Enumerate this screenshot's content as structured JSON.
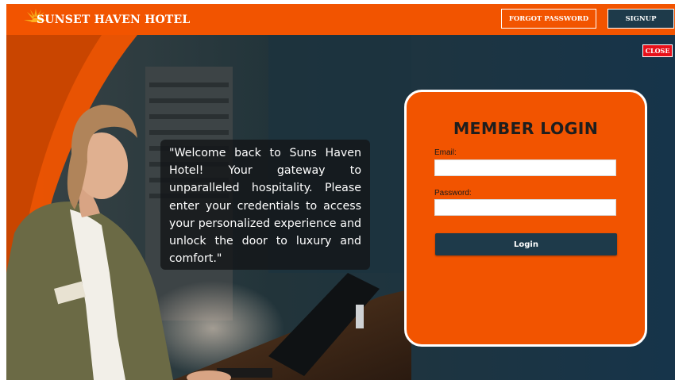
{
  "header": {
    "brand": "SUNSET HAVEN HOTEL",
    "forgot_password_label": "FORGOT PASSWORD",
    "signup_label": "SIGNUP"
  },
  "close_label": "CLOSE",
  "welcome_message": "\"Welcome back to Suns Haven Hotel! Your gateway to unparalleled hospitality. Please enter your credentials to access your personalized experience and unlock the door to luxury and comfort.\"",
  "login": {
    "title": "MEMBER LOGIN",
    "email_label": "Email:",
    "email_value": "",
    "password_label": "Password:",
    "password_value": "",
    "submit_label": "Login"
  },
  "colors": {
    "brand_orange": "#f25400",
    "navy": "#1e3a4a",
    "close_red": "#e8101a"
  },
  "icons": {
    "logo": "sun-logo-icon"
  }
}
